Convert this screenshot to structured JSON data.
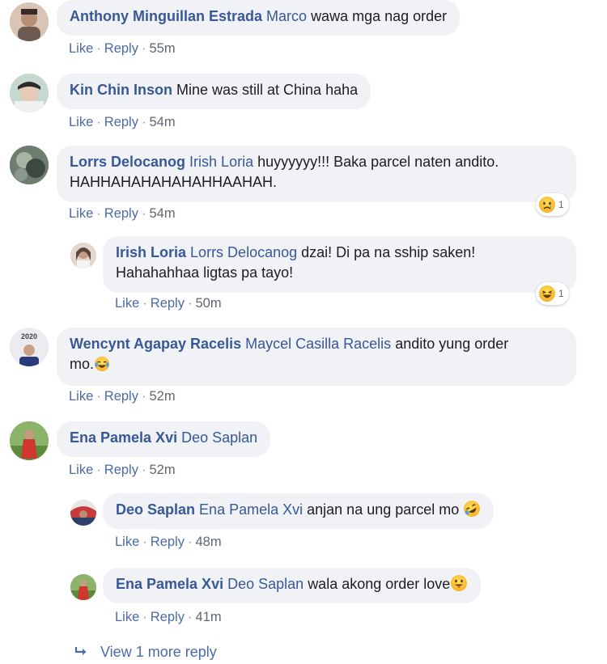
{
  "actions": {
    "like": "Like",
    "reply": "Reply",
    "dot": "·"
  },
  "comments": [
    {
      "author": "Anthony Minguillan Estrada",
      "tag": "Marco",
      "text": "wawa mga nag order",
      "time": "55m"
    },
    {
      "author": "Kin Chin Inson",
      "tag": "",
      "text": "Mine was still at China haha",
      "time": "54m"
    },
    {
      "author": "Lorrs Delocanog",
      "tag": "Irish Loria",
      "text": "huyyyyyy!!! Baka parcel naten andito.",
      "text2": "HAHHAHAHAHAHAHHAAHAH.",
      "time": "54m",
      "reaction_icon": "sad-emoji-icon",
      "reaction_count": "1"
    },
    {
      "author": "Irish Loria",
      "tag": "Lorrs Delocanog",
      "text": "dzai! Di pa na sship saken!",
      "text2": "Hahahahhaa ligtas pa tayo!",
      "time": "50m",
      "reaction_icon": "haha-emoji-icon",
      "reaction_count": "1"
    },
    {
      "author": "Wencynt Agapay Racelis",
      "tag": "Maycel Casilla Racelis",
      "text": "andito yung order",
      "text2": "mo.",
      "time": "52m",
      "trailing_emoji": "tears-of-joy-emoji"
    },
    {
      "author": "Ena Pamela Xvi",
      "tag": "Deo Saplan",
      "text": "",
      "time": "52m"
    },
    {
      "author": "Deo Saplan",
      "tag": "Ena Pamela Xvi",
      "text": "anjan na ung parcel mo",
      "time": "48m",
      "trailing_emoji": "rolling-laughing-emoji"
    },
    {
      "author": "Ena Pamela Xvi",
      "tag": "Deo Saplan",
      "text": "wala akong order love",
      "time": "41m",
      "trailing_emoji": "tongue-out-emoji"
    }
  ],
  "view_more": {
    "label": "View 1 more reply",
    "icon": "reply-arrow-icon"
  },
  "colors": {
    "link": "#385898",
    "action": "#4b6aa8",
    "bubble": "#f0f2f5",
    "text": "#1c1e21"
  }
}
